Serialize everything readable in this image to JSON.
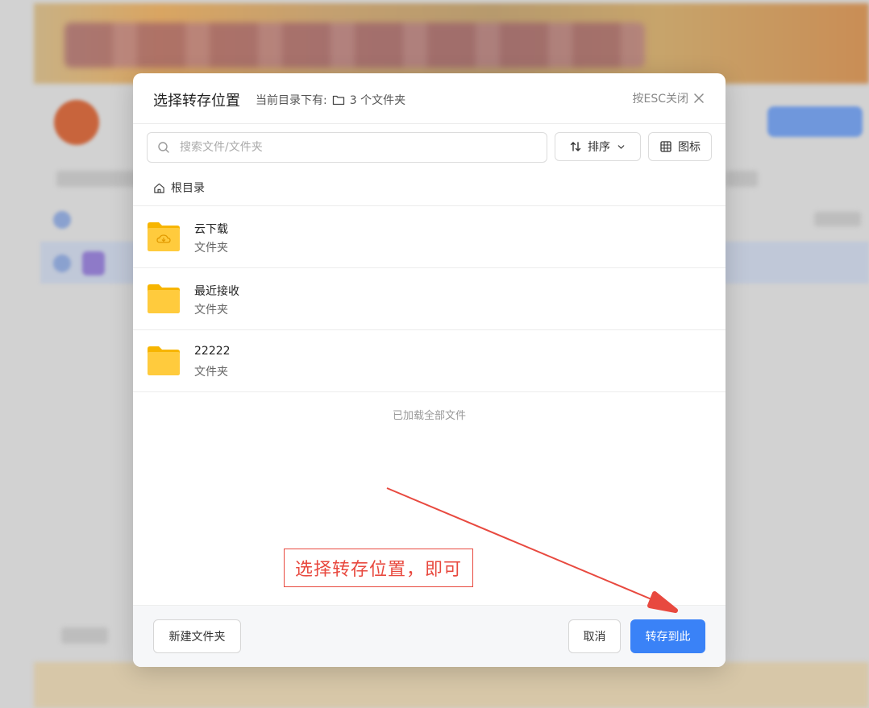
{
  "dialog": {
    "title": "选择转存位置",
    "subtitle_prefix": "当前目录下有:",
    "folder_count_text": "3 个文件夹",
    "close_hint": "按ESC关闭"
  },
  "toolbar": {
    "search_placeholder": "搜索文件/文件夹",
    "sort_label": "排序",
    "view_label": "图标"
  },
  "breadcrumb": {
    "root_label": "根目录"
  },
  "folders": [
    {
      "name": "云下载",
      "type": "文件夹",
      "icon": "cloud-folder-icon"
    },
    {
      "name": "最近接收",
      "type": "文件夹",
      "icon": "folder-icon"
    },
    {
      "name": "22222",
      "type": "文件夹",
      "icon": "folder-icon"
    }
  ],
  "list_status": "已加载全部文件",
  "footer": {
    "new_folder_label": "新建文件夹",
    "cancel_label": "取消",
    "confirm_label": "转存到此"
  },
  "annotation": {
    "text": "选择转存位置，即可"
  },
  "colors": {
    "accent": "#3a82f7",
    "folder": "#fbc531",
    "annotation": "#e8493f"
  }
}
